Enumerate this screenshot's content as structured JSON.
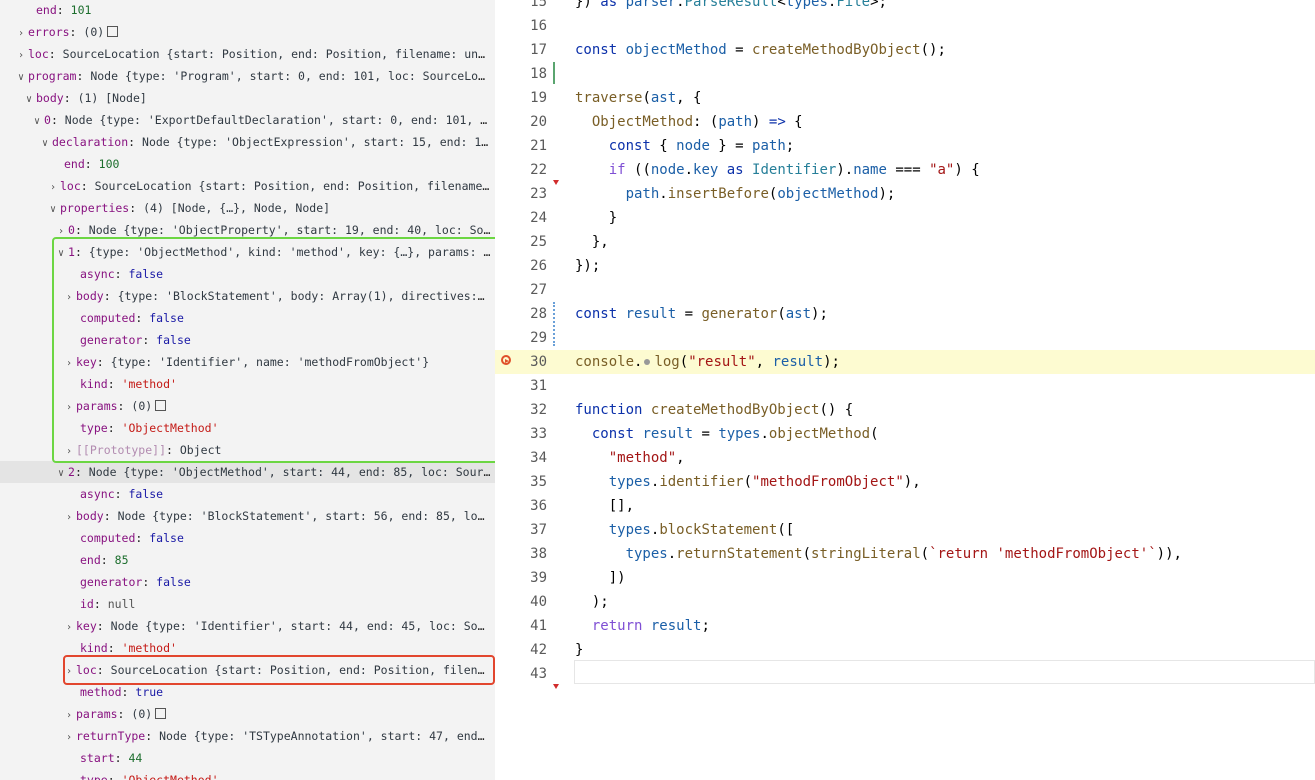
{
  "tree": {
    "rows": [
      {
        "indent": 22,
        "toggle": "none",
        "key": "end",
        "value": "101",
        "vtype": "num-green"
      },
      {
        "indent": 14,
        "toggle": "closed",
        "key": "errors",
        "value": "(0)",
        "vtype": "obj",
        "emptybox": true
      },
      {
        "indent": 14,
        "toggle": "closed",
        "key": "loc",
        "value": "SourceLocation {start: Position, end: Position, filename: undefi…",
        "vtype": "obj"
      },
      {
        "indent": 14,
        "toggle": "open",
        "key": "program",
        "value": "Node {type: 'Program', start: 0, end: 101, loc: SourceLocati…",
        "vtype": "obj"
      },
      {
        "indent": 22,
        "toggle": "open",
        "key": "body",
        "value": "(1) [Node]",
        "vtype": "obj"
      },
      {
        "indent": 30,
        "toggle": "open",
        "key": "0",
        "value": "Node {type: 'ExportDefaultDeclaration', start: 0, end: 101, loc…",
        "vtype": "obj"
      },
      {
        "indent": 38,
        "toggle": "open",
        "key": "declaration",
        "value": "Node {type: 'ObjectExpression', start: 15, end: 100,…",
        "vtype": "obj"
      },
      {
        "indent": 50,
        "toggle": "none",
        "key": "end",
        "value": "100",
        "vtype": "num-green"
      },
      {
        "indent": 46,
        "toggle": "closed",
        "key": "loc",
        "value": "SourceLocation {start: Position, end: Position, filename: u…",
        "vtype": "obj"
      },
      {
        "indent": 46,
        "toggle": "open",
        "key": "properties",
        "value": "(4) [Node, {…}, Node, Node]",
        "vtype": "obj"
      },
      {
        "indent": 54,
        "toggle": "closed",
        "key": "0",
        "value": "Node {type: 'ObjectProperty', start: 19, end: 40, loc: Sourc…",
        "vtype": "obj"
      },
      {
        "indent": 54,
        "toggle": "open",
        "key": "1",
        "value": "{type: 'ObjectMethod', kind: 'method', key: {…}, params: Arr…",
        "vtype": "obj"
      },
      {
        "indent": 66,
        "toggle": "none",
        "key": "async",
        "value": "false",
        "vtype": "bool"
      },
      {
        "indent": 62,
        "toggle": "closed",
        "key": "body",
        "value": "{type: 'BlockStatement', body: Array(1), directives: Ar…",
        "vtype": "obj"
      },
      {
        "indent": 66,
        "toggle": "none",
        "key": "computed",
        "value": "false",
        "vtype": "bool"
      },
      {
        "indent": 66,
        "toggle": "none",
        "key": "generator",
        "value": "false",
        "vtype": "bool"
      },
      {
        "indent": 62,
        "toggle": "closed",
        "key": "key",
        "value": "{type: 'Identifier', name: 'methodFromObject'}",
        "vtype": "obj"
      },
      {
        "indent": 66,
        "toggle": "none",
        "key": "kind",
        "value": "'method'",
        "vtype": "str"
      },
      {
        "indent": 62,
        "toggle": "closed",
        "key": "params",
        "value": "(0)",
        "vtype": "obj",
        "emptybox": true
      },
      {
        "indent": 66,
        "toggle": "none",
        "key": "type",
        "value": "'ObjectMethod'",
        "vtype": "str"
      },
      {
        "indent": 62,
        "toggle": "closed",
        "key": "[[Prototype]]",
        "value": "Object",
        "vtype": "obj",
        "dim": true
      },
      {
        "indent": 54,
        "toggle": "open",
        "key": "2",
        "value": "Node {type: 'ObjectMethod', start: 44, end: 85, loc: Source…",
        "vtype": "obj",
        "highlight": true
      },
      {
        "indent": 66,
        "toggle": "none",
        "key": "async",
        "value": "false",
        "vtype": "bool"
      },
      {
        "indent": 62,
        "toggle": "closed",
        "key": "body",
        "value": "Node {type: 'BlockStatement', start: 56, end: 85, loc: …",
        "vtype": "obj"
      },
      {
        "indent": 66,
        "toggle": "none",
        "key": "computed",
        "value": "false",
        "vtype": "bool"
      },
      {
        "indent": 66,
        "toggle": "none",
        "key": "end",
        "value": "85",
        "vtype": "num-green"
      },
      {
        "indent": 66,
        "toggle": "none",
        "key": "generator",
        "value": "false",
        "vtype": "bool"
      },
      {
        "indent": 66,
        "toggle": "none",
        "key": "id",
        "value": "null",
        "vtype": "null"
      },
      {
        "indent": 62,
        "toggle": "closed",
        "key": "key",
        "value": "Node {type: 'Identifier', start: 44, end: 45, loc: Sourc…",
        "vtype": "obj"
      },
      {
        "indent": 66,
        "toggle": "none",
        "key": "kind",
        "value": "'method'",
        "vtype": "str"
      },
      {
        "indent": 62,
        "toggle": "closed",
        "key": "loc",
        "value": "SourceLocation {start: Position, end: Position, filename…",
        "vtype": "obj"
      },
      {
        "indent": 66,
        "toggle": "none",
        "key": "method",
        "value": "true",
        "vtype": "bool"
      },
      {
        "indent": 62,
        "toggle": "closed",
        "key": "params",
        "value": "(0)",
        "vtype": "obj",
        "emptybox": true
      },
      {
        "indent": 62,
        "toggle": "closed",
        "key": "returnType",
        "value": "Node {type: 'TSTypeAnnotation', start: 47, end: 5…",
        "vtype": "obj"
      },
      {
        "indent": 66,
        "toggle": "none",
        "key": "start",
        "value": "44",
        "vtype": "num-green"
      },
      {
        "indent": 66,
        "toggle": "none",
        "key": "type",
        "value": "'ObjectMethod'",
        "vtype": "str"
      }
    ]
  },
  "editor": {
    "current_line": 30,
    "breakpoint_line": 30,
    "lines": [
      {
        "n": "15",
        "t": [
          [
            "pun",
            "}) "
          ],
          [
            "kw",
            "as "
          ],
          [
            "var",
            "parser"
          ],
          [
            "pun",
            "."
          ],
          [
            "typ",
            "ParseResult"
          ],
          [
            "pun",
            "<"
          ],
          [
            "var",
            "types"
          ],
          [
            "pun",
            "."
          ],
          [
            "typ",
            "File"
          ],
          [
            "pun",
            ">;"
          ]
        ]
      },
      {
        "n": "16",
        "t": []
      },
      {
        "n": "17",
        "t": [
          [
            "kw",
            "const "
          ],
          [
            "var",
            "objectMethod"
          ],
          [
            "pun",
            " = "
          ],
          [
            "fn",
            "createMethodByObject"
          ],
          [
            "pun",
            "();"
          ]
        ]
      },
      {
        "n": "18",
        "t": []
      },
      {
        "n": "19",
        "t": [
          [
            "fn",
            "traverse"
          ],
          [
            "pun",
            "("
          ],
          [
            "var",
            "ast"
          ],
          [
            "pun",
            ", {"
          ]
        ]
      },
      {
        "n": "20",
        "t": [
          [
            "pun",
            "  "
          ],
          [
            "fn",
            "ObjectMethod"
          ],
          [
            "pun",
            ": ("
          ],
          [
            "var",
            "path"
          ],
          [
            "pun",
            ") "
          ],
          [
            "kw",
            "=>"
          ],
          [
            "pun",
            " {"
          ]
        ]
      },
      {
        "n": "21",
        "t": [
          [
            "pun",
            "    "
          ],
          [
            "kw",
            "const "
          ],
          [
            "pun",
            "{ "
          ],
          [
            "var",
            "node"
          ],
          [
            "pun",
            " } = "
          ],
          [
            "var",
            "path"
          ],
          [
            "pun",
            ";"
          ]
        ]
      },
      {
        "n": "22",
        "t": [
          [
            "pun",
            "    "
          ],
          [
            "pr",
            "if "
          ],
          [
            "pun",
            "(("
          ],
          [
            "var",
            "node"
          ],
          [
            "pun",
            "."
          ],
          [
            "var",
            "key "
          ],
          [
            "kw",
            "as "
          ],
          [
            "typ",
            "Identifier"
          ],
          [
            "pun",
            ")."
          ],
          [
            "var",
            "name"
          ],
          [
            "pun",
            " === "
          ],
          [
            "str",
            "\"a\""
          ],
          [
            "pun",
            ") {"
          ]
        ]
      },
      {
        "n": "23",
        "t": [
          [
            "pun",
            "      "
          ],
          [
            "var",
            "path"
          ],
          [
            "pun",
            "."
          ],
          [
            "fn",
            "insertBefore"
          ],
          [
            "pun",
            "("
          ],
          [
            "var",
            "objectMethod"
          ],
          [
            "pun",
            ");"
          ]
        ]
      },
      {
        "n": "24",
        "t": [
          [
            "pun",
            "    }"
          ]
        ]
      },
      {
        "n": "25",
        "t": [
          [
            "pun",
            "  },"
          ]
        ]
      },
      {
        "n": "26",
        "t": [
          [
            "pun",
            "});"
          ]
        ]
      },
      {
        "n": "27",
        "t": []
      },
      {
        "n": "28",
        "t": [
          [
            "kw",
            "const "
          ],
          [
            "var",
            "result"
          ],
          [
            "pun",
            " = "
          ],
          [
            "fn",
            "generator"
          ],
          [
            "pun",
            "("
          ],
          [
            "var",
            "ast"
          ],
          [
            "pun",
            ");"
          ]
        ]
      },
      {
        "n": "29",
        "t": []
      },
      {
        "n": "30",
        "t": [
          [
            "fn",
            "console"
          ],
          [
            "pun",
            "."
          ],
          [
            "dot",
            ""
          ],
          [
            "fn",
            "log"
          ],
          [
            "pun",
            "("
          ],
          [
            "str",
            "\"result\""
          ],
          [
            "pun",
            ", "
          ],
          [
            "var",
            "result"
          ],
          [
            "pun",
            ");"
          ]
        ]
      },
      {
        "n": "31",
        "t": []
      },
      {
        "n": "32",
        "t": [
          [
            "kw",
            "function "
          ],
          [
            "fn",
            "createMethodByObject"
          ],
          [
            "pun",
            "() {"
          ]
        ]
      },
      {
        "n": "33",
        "t": [
          [
            "pun",
            "  "
          ],
          [
            "kw",
            "const "
          ],
          [
            "var",
            "result"
          ],
          [
            "pun",
            " = "
          ],
          [
            "var",
            "types"
          ],
          [
            "pun",
            "."
          ],
          [
            "fn",
            "objectMethod"
          ],
          [
            "pun",
            "("
          ]
        ]
      },
      {
        "n": "34",
        "t": [
          [
            "pun",
            "    "
          ],
          [
            "str",
            "\"method\""
          ],
          [
            "pun",
            ","
          ]
        ]
      },
      {
        "n": "35",
        "t": [
          [
            "pun",
            "    "
          ],
          [
            "var",
            "types"
          ],
          [
            "pun",
            "."
          ],
          [
            "fn",
            "identifier"
          ],
          [
            "pun",
            "("
          ],
          [
            "str",
            "\"methodFromObject\""
          ],
          [
            "pun",
            "),"
          ]
        ]
      },
      {
        "n": "36",
        "t": [
          [
            "pun",
            "    [],"
          ]
        ]
      },
      {
        "n": "37",
        "t": [
          [
            "pun",
            "    "
          ],
          [
            "var",
            "types"
          ],
          [
            "pun",
            "."
          ],
          [
            "fn",
            "blockStatement"
          ],
          [
            "pun",
            "(["
          ]
        ]
      },
      {
        "n": "38",
        "t": [
          [
            "pun",
            "      "
          ],
          [
            "var",
            "types"
          ],
          [
            "pun",
            "."
          ],
          [
            "fn",
            "returnStatement"
          ],
          [
            "pun",
            "("
          ],
          [
            "fn",
            "stringLiteral"
          ],
          [
            "pun",
            "("
          ],
          [
            "str",
            "`return 'methodFromObject'`"
          ],
          [
            "pun",
            ")),"
          ]
        ]
      },
      {
        "n": "39",
        "t": [
          [
            "pun",
            "    ])"
          ]
        ]
      },
      {
        "n": "40",
        "t": [
          [
            "pun",
            "  );"
          ]
        ]
      },
      {
        "n": "41",
        "t": [
          [
            "pun",
            "  "
          ],
          [
            "pr",
            "return "
          ],
          [
            "var",
            "result"
          ],
          [
            "pun",
            ";"
          ]
        ]
      },
      {
        "n": "42",
        "t": [
          [
            "pun",
            "}"
          ]
        ]
      },
      {
        "n": "43",
        "t": []
      }
    ]
  }
}
